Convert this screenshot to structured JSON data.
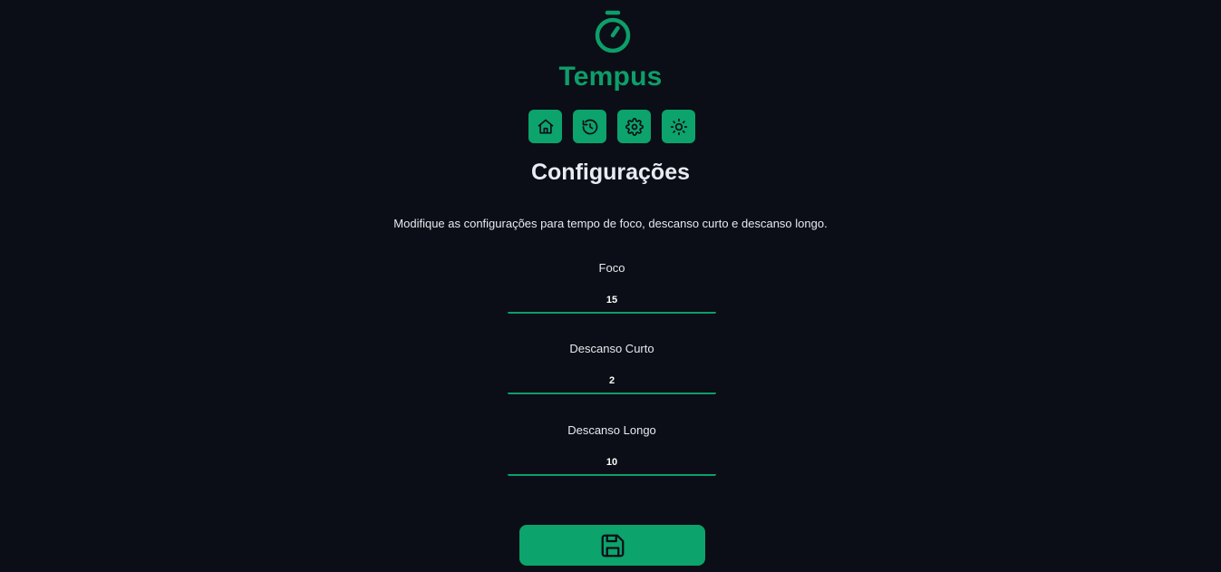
{
  "app": {
    "title": "Tempus",
    "logo_icon": "stopwatch-icon"
  },
  "nav": {
    "items": [
      {
        "icon": "home-icon"
      },
      {
        "icon": "history-icon"
      },
      {
        "icon": "gear-icon"
      },
      {
        "icon": "sun-icon"
      }
    ]
  },
  "settings": {
    "title": "Configurações",
    "description": "Modifique as configurações para tempo de foco, descanso curto e descanso longo.",
    "fields": [
      {
        "label": "Foco",
        "value": "15"
      },
      {
        "label": "Descanso Curto",
        "value": "2"
      },
      {
        "label": "Descanso Longo",
        "value": "10"
      }
    ],
    "save_icon": "save-icon"
  },
  "colors": {
    "background": "#0b0e16",
    "accent": "#0d9e6a",
    "button": "#0da36c",
    "icon_on_button": "#0b0e16",
    "text": "#e6e9ef"
  }
}
